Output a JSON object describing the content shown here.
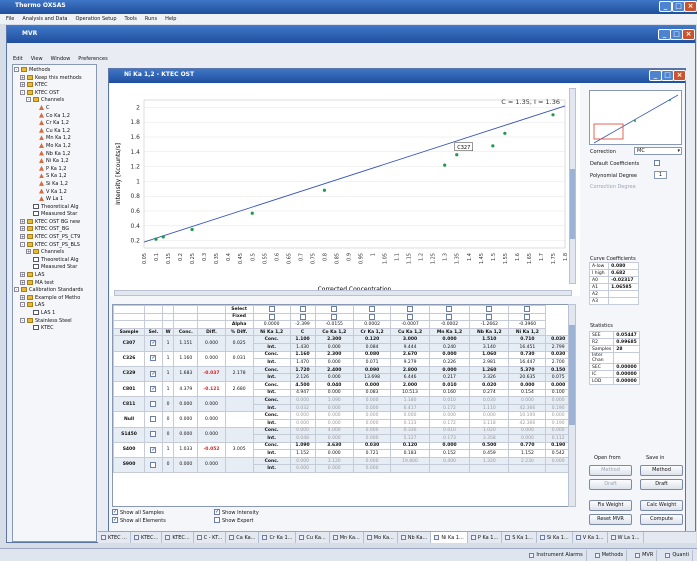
{
  "app": {
    "title": "Thermo OXSAS",
    "menu": [
      "File",
      "Analysis and Data",
      "Operation Setup",
      "Tools",
      "Runs",
      "Help"
    ]
  },
  "win": {
    "title": "MVR",
    "menu": [
      "Edit",
      "View",
      "Window",
      "Preferences"
    ]
  },
  "tree": [
    {
      "d": 0,
      "t": "Methods",
      "i": "fold",
      "x": "-"
    },
    {
      "d": 1,
      "t": "Keep this methods",
      "i": "fold",
      "x": "+"
    },
    {
      "d": 1,
      "t": "KTEC",
      "i": "fold",
      "x": "+"
    },
    {
      "d": 1,
      "t": "KTEC OST",
      "i": "fold",
      "x": "-"
    },
    {
      "d": 2,
      "t": "Channels",
      "i": "fold",
      "x": "-"
    },
    {
      "d": 3,
      "t": "C",
      "i": "chan"
    },
    {
      "d": 3,
      "t": "Co Ka 1,2",
      "i": "chan"
    },
    {
      "d": 3,
      "t": "Cr Ka 1,2",
      "i": "chan"
    },
    {
      "d": 3,
      "t": "Cu Ka 1,2",
      "i": "chan"
    },
    {
      "d": 3,
      "t": "Mn Ka 1,2",
      "i": "chan"
    },
    {
      "d": 3,
      "t": "Mo Ka 1,2",
      "i": "chan"
    },
    {
      "d": 3,
      "t": "Nb Ka 1,2",
      "i": "chan"
    },
    {
      "d": 3,
      "t": "Ni Ka 1,2",
      "i": "chan"
    },
    {
      "d": 3,
      "t": "P Ka 1,2",
      "i": "chan"
    },
    {
      "d": 3,
      "t": "S Ka 1,2",
      "i": "chan"
    },
    {
      "d": 3,
      "t": "Si Ka 1,2",
      "i": "chan"
    },
    {
      "d": 3,
      "t": "V Ka 1,2",
      "i": "chan"
    },
    {
      "d": 3,
      "t": "W La 1",
      "i": "chan"
    },
    {
      "d": 2,
      "t": "Theoretical Alg",
      "i": "doc"
    },
    {
      "d": 2,
      "t": "Measured Star",
      "i": "doc"
    },
    {
      "d": 1,
      "t": "KTEC OST BG new",
      "i": "fold",
      "x": "+"
    },
    {
      "d": 1,
      "t": "KTEC OST_BG",
      "i": "fold",
      "x": "+"
    },
    {
      "d": 1,
      "t": "KTEC OST_PS_CT9",
      "i": "fold",
      "x": "+"
    },
    {
      "d": 1,
      "t": "KTEC OST_PS_BLS",
      "i": "fold",
      "x": "-"
    },
    {
      "d": 2,
      "t": "Channels",
      "i": "fold",
      "x": "+"
    },
    {
      "d": 2,
      "t": "Theoretical Alg",
      "i": "doc"
    },
    {
      "d": 2,
      "t": "Measured Star",
      "i": "doc"
    },
    {
      "d": 1,
      "t": "LAS",
      "i": "fold",
      "x": "+"
    },
    {
      "d": 1,
      "t": "MA test",
      "i": "fold",
      "x": "+"
    },
    {
      "d": 0,
      "t": "Calibration Standards",
      "i": "fold",
      "x": "-"
    },
    {
      "d": 1,
      "t": "Example of Metho",
      "i": "fold",
      "x": "+"
    },
    {
      "d": 1,
      "t": "LAS",
      "i": "fold",
      "x": "-"
    },
    {
      "d": 2,
      "t": "LAS 1",
      "i": "doc"
    },
    {
      "d": 1,
      "t": "Stainless Steel",
      "i": "fold",
      "x": "-"
    },
    {
      "d": 2,
      "t": "KTEC",
      "i": "doc"
    }
  ],
  "chart_win": {
    "title": "Ni Ka 1,2 - KTEC OST"
  },
  "chart_data": {
    "type": "scatter",
    "annotation": "C = 1.35, I = 1.36",
    "callout": "C327",
    "xlabel": "Corrected Concentration",
    "ylabel": "Intensity [Kcounts/s]",
    "xlim": [
      0.05,
      1.8
    ],
    "ylim": [
      0.1,
      2.1
    ],
    "xticks": [
      "0.05",
      "0.1",
      "0.15",
      "0.2",
      "0.25",
      "0.3",
      "0.35",
      "0.4",
      "0.45",
      "0.5",
      "0.55",
      "0.6",
      "0.65",
      "0.7",
      "0.75",
      "0.8",
      "0.85",
      "0.9",
      "0.95",
      "1",
      "1.05",
      "1.1",
      "1.15",
      "1.2",
      "1.25",
      "1.3",
      "1.35",
      "1.4",
      "1.45",
      "1.5",
      "1.55",
      "1.6",
      "1.65",
      "1.7",
      "1.75",
      "1.8"
    ],
    "yticks": [
      "0.2",
      "0.4",
      "0.6",
      "0.8",
      "1",
      "1.2",
      "1.4",
      "1.6",
      "1.8",
      "2"
    ],
    "fit": [
      [
        0.05,
        0.18
      ],
      [
        1.8,
        2.02
      ]
    ],
    "points": [
      [
        0.1,
        0.22
      ],
      [
        0.13,
        0.25
      ],
      [
        0.25,
        0.35
      ],
      [
        0.5,
        0.57
      ],
      [
        0.8,
        0.88
      ],
      [
        1.3,
        1.22
      ],
      [
        1.35,
        1.36
      ],
      [
        1.5,
        1.48
      ],
      [
        1.55,
        1.65
      ],
      [
        1.75,
        1.9
      ]
    ]
  },
  "table": {
    "select_label": "Select",
    "fixed_label": "Fixed",
    "alpha_label": "Alpha",
    "alphas": [
      "0.0000",
      "-2.399",
      "-0.0155",
      "0.0002",
      "-0.0007",
      "-0.0002",
      "-1.2662",
      "-0.3960"
    ],
    "elements": [
      "Ni Ka 1,2",
      "C",
      "Co Ka 1,2",
      "Cr Ka 1,2",
      "Cu Ka 1,2",
      "Mn Ka 1,2",
      "Nb Ka 1,2",
      "Ni Ka 1,2"
    ],
    "fixed": [
      false,
      false,
      false,
      false,
      false,
      false,
      false,
      false
    ],
    "head": [
      "Sample",
      "Sel.",
      "W",
      "Conc.",
      "Diff.",
      "% Diff."
    ],
    "samples": [
      {
        "id": "C307",
        "sel": true,
        "w": "1",
        "conc": "1.151",
        "diff": "0.000",
        "pct": "0.025",
        "red": false,
        "conc_row": [
          "1.100",
          "2.300",
          "0.120",
          "3.000",
          "0.000",
          "1.510",
          "0.710",
          "0.030"
        ],
        "int_row": [
          "1.430",
          "0.000",
          "0.084",
          "9.444",
          "0.240",
          "3.140",
          "16.451",
          "2.799"
        ]
      },
      {
        "id": "C326",
        "sel": true,
        "w": "1",
        "conc": "1.160",
        "diff": "0.000",
        "pct": "0.031",
        "red": false,
        "conc_row": [
          "1.160",
          "2.300",
          "0.080",
          "2.670",
          "0.000",
          "1.060",
          "0.730",
          "0.030"
        ],
        "int_row": [
          "1.470",
          "0.000",
          "0.071",
          "9.279",
          "0.226",
          "2.981",
          "16.447",
          "2.700"
        ]
      },
      {
        "id": "C329",
        "sel": true,
        "w": "1",
        "conc": "1.683",
        "diff": "-0.037",
        "pct": "2.178",
        "red": true,
        "conc_row": [
          "1.720",
          "2.400",
          "0.090",
          "2.800",
          "0.000",
          "1.260",
          "5.370",
          "0.150"
        ],
        "int_row": [
          "2.126",
          "0.000",
          "13.698",
          "6.446",
          "0.217",
          "3.326",
          "20.635",
          "0.075"
        ]
      },
      {
        "id": "C801",
        "sel": true,
        "w": "1",
        "conc": "4.379",
        "diff": "-0.121",
        "pct": "2.680",
        "red": true,
        "conc_row": [
          "4.500",
          "0.040",
          "0.000",
          "2.000",
          "0.010",
          "0.020",
          "0.000",
          "0.000"
        ],
        "int_row": [
          "4.947",
          "0.000",
          "0.083",
          "10.513",
          "0.160",
          "0.274",
          "0.154",
          "0.100"
        ]
      },
      {
        "id": "C811",
        "sel": false,
        "w": "0",
        "conc": "0.000",
        "diff": "0.000",
        "pct": "",
        "red": false,
        "conc_row": [
          "0.000",
          "1.090",
          "0.000",
          "1.180",
          "0.010",
          "0.030",
          "0.000",
          "0.000"
        ],
        "int_row": [
          "0.032",
          "0.000",
          "0.000",
          "6.417",
          "0.172",
          "1.110",
          "42.366",
          "0.190"
        ]
      },
      {
        "id": "Null",
        "sel": false,
        "w": "0",
        "conc": "0.000",
        "diff": "0.000",
        "pct": "",
        "red": false,
        "conc_row": [
          "0.000",
          "0.000",
          "0.000",
          "0.000",
          "0.000",
          "0.000",
          "10.100",
          "0.000"
        ],
        "int_row": [
          "0.000",
          "0.000",
          "0.000",
          "0.133",
          "0.172",
          "3.118",
          "42.366",
          "0.190"
        ]
      },
      {
        "id": "S1450",
        "sel": false,
        "w": "0",
        "conc": "0.000",
        "diff": "0.000",
        "pct": "",
        "red": false,
        "conc_row": [
          "0.000",
          "4.000",
          "0.000",
          "0.330",
          "0.010",
          "1.020",
          "0.000",
          "0.000"
        ],
        "int_row": [
          "0.048",
          "0.000",
          "0.000",
          "5.127",
          "0.173",
          "3.358",
          "0.000",
          "0.112"
        ]
      },
      {
        "id": "S400",
        "sel": true,
        "w": "1",
        "conc": "1.033",
        "diff": "-0.052",
        "pct": "3.005",
        "red": true,
        "conc_row": [
          "1.090",
          "3.630",
          "0.030",
          "0.120",
          "0.000",
          "0.500",
          "0.770",
          "0.190"
        ],
        "int_row": [
          "1.152",
          "0.000",
          "0.721",
          "0.183",
          "0.152",
          "0.459",
          "1.152",
          "0.542"
        ]
      },
      {
        "id": "S900",
        "sel": false,
        "w": "0",
        "conc": "0.000",
        "diff": "0.000",
        "pct": "",
        "red": false,
        "conc_row": [
          "0.000",
          "3.120",
          "0.000",
          "19.800",
          "0.400",
          "1.320",
          "2.230",
          "0.000"
        ],
        "int_row": [
          "0.000",
          "0.000",
          "0.000",
          "",
          "",
          "",
          "",
          ""
        ]
      }
    ],
    "conc_label": "Conc.",
    "int_label": "Int."
  },
  "checks": [
    {
      "label": "Show all Samples",
      "on": true
    },
    {
      "label": "Show all Elements",
      "on": true
    },
    {
      "label": "Show Intensity",
      "on": true
    },
    {
      "label": "Show Expert",
      "on": false
    }
  ],
  "panel": {
    "correction_label": "Correction",
    "correction_val": "MC",
    "default_coef": "Default Coefficients",
    "poly_label": "Polynomial Degree",
    "poly_val": "1",
    "cv_label": "Correction Degree",
    "curve_title": "Curve Coefficients",
    "curve": [
      [
        "A-low",
        "0.080"
      ],
      [
        "I high",
        "0.682"
      ],
      [
        "A0",
        "-0.02317"
      ],
      [
        "A1",
        "1.06585"
      ],
      [
        "A2",
        ""
      ],
      [
        "A3",
        ""
      ]
    ],
    "stat_title": "Statistics",
    "stats": [
      [
        "SEE",
        "0.05447"
      ],
      [
        "R2",
        "0.99685"
      ],
      [
        "Samples",
        "28"
      ],
      [
        "Inter Chan",
        ""
      ],
      [
        "SEC",
        "0.00000"
      ],
      [
        "IC",
        "0.00000"
      ],
      [
        "LOD",
        "0.00000"
      ]
    ],
    "open_from": "Open from",
    "save_in": "Save in",
    "b_method": "Method",
    "b_draft": "Draft",
    "b_fix": "Fix Weight",
    "b_calc": "Calc Weight",
    "b_reset": "Reset MVR",
    "b_compute": "Compute"
  },
  "tabs": [
    "KTEC ...",
    "KTEC...",
    "KTEC...",
    "C - KT...",
    "Ca Ka...",
    "Cr Ka 1...",
    "Cu Ka...",
    "Mn Ka...",
    "Mo Ka...",
    "Nb Ka...",
    "Ni Ka 1...",
    "P Ka 1...",
    "S Ka 1...",
    "Si Ka 1...",
    "V Ka 1...",
    "W La 1..."
  ],
  "status": [
    "Instrument Alarms",
    "Methods",
    "MVR",
    "Quanti"
  ],
  "colors": {
    "accent": "#2f5fa8",
    "point": "#1c9a52",
    "line": "#3856b7",
    "red": "#d02424"
  }
}
